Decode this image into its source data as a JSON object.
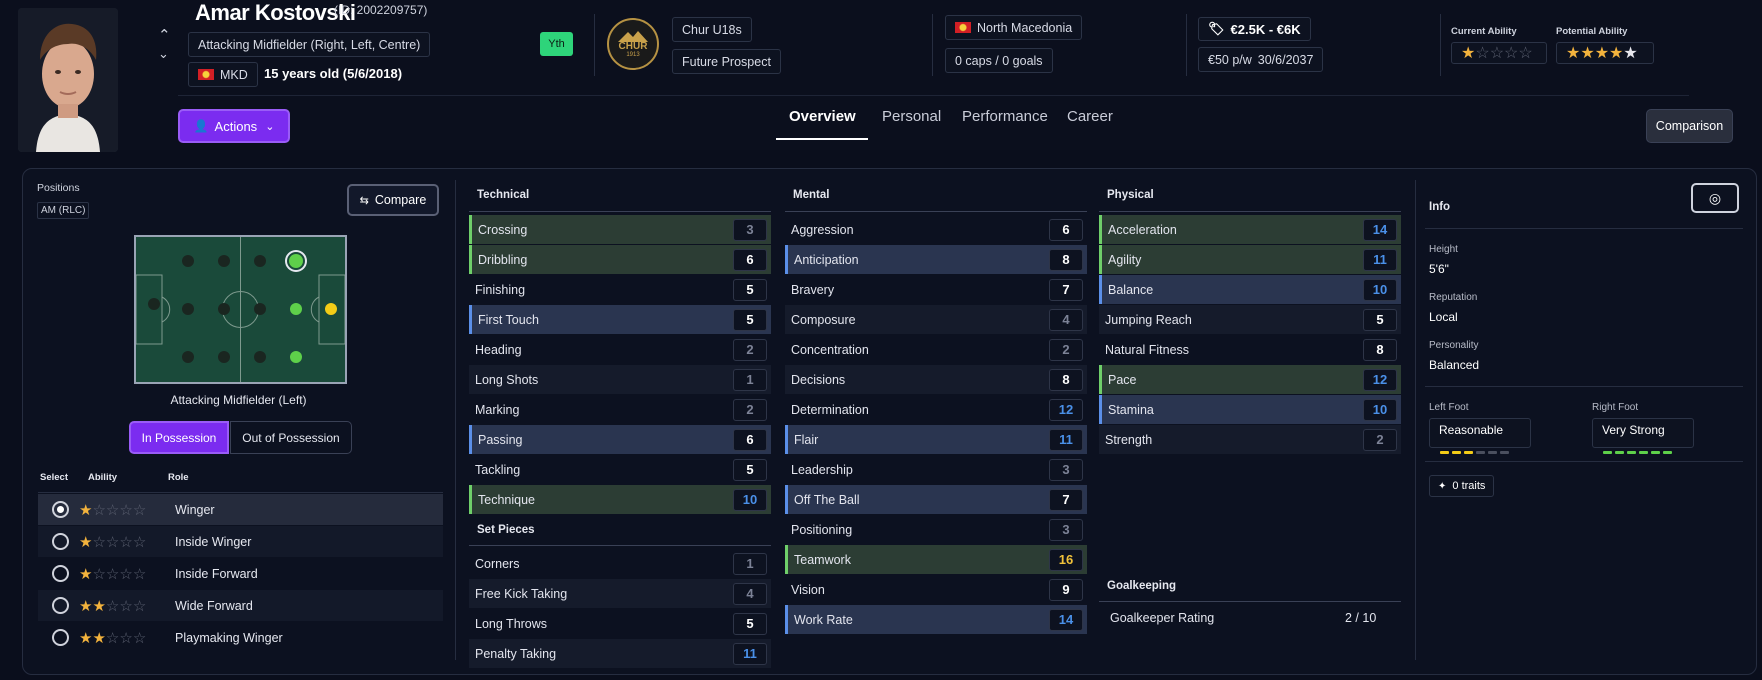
{
  "player": {
    "name": "Amar Kostovski",
    "id": "(ID: 2002209757)",
    "position": "Attacking Midfielder (Right, Left, Centre)",
    "nationality_code": "MKD",
    "age": "15 years old (5/6/2018)",
    "youth_badge": "Yth",
    "club_logo_text": "CHUR",
    "club_logo_year": "1913",
    "team": "Chur U18s",
    "status": "Future Prospect",
    "country": "North Macedonia",
    "caps": "0 caps / 0 goals",
    "value": "€2.5K - €6K",
    "wage": "€50 p/w",
    "contract": "30/6/2037",
    "current_ability_label": "Current Ability",
    "potential_ability_label": "Potential Ability",
    "current_ability_stars": 1,
    "potential_ability_stars": 4.5
  },
  "toolbar": {
    "actions_label": "Actions",
    "comparison_label": "Comparison"
  },
  "tabs": [
    "Overview",
    "Personal",
    "Performance",
    "Career"
  ],
  "positions_panel": {
    "title": "Positions",
    "short": "AM (RLC)",
    "compare_label": "Compare",
    "pitch_caption": "Attacking Midfielder (Left)",
    "in_possession": "In Possession",
    "out_possession": "Out of Possession",
    "col_select": "Select",
    "col_ability": "Ability",
    "col_role": "Role",
    "roles": [
      {
        "name": "Winger",
        "stars": 1,
        "selected": true
      },
      {
        "name": "Inside Winger",
        "stars": 1,
        "selected": false
      },
      {
        "name": "Inside Forward",
        "stars": 1,
        "selected": false
      },
      {
        "name": "Wide Forward",
        "stars": 2,
        "selected": false
      },
      {
        "name": "Playmaking Winger",
        "stars": 2,
        "selected": false
      }
    ]
  },
  "technical": {
    "title": "Technical",
    "rows": [
      {
        "name": "Crossing",
        "value": "3",
        "hl": "green"
      },
      {
        "name": "Dribbling",
        "value": "6",
        "hl": "green"
      },
      {
        "name": "Finishing",
        "value": "5",
        "hl": ""
      },
      {
        "name": "First Touch",
        "value": "5",
        "hl": "blue"
      },
      {
        "name": "Heading",
        "value": "2",
        "hl": ""
      },
      {
        "name": "Long Shots",
        "value": "1",
        "hl": ""
      },
      {
        "name": "Marking",
        "value": "2",
        "hl": ""
      },
      {
        "name": "Passing",
        "value": "6",
        "hl": "blue"
      },
      {
        "name": "Tackling",
        "value": "5",
        "hl": ""
      },
      {
        "name": "Technique",
        "value": "10",
        "hl": "green"
      }
    ]
  },
  "set_pieces": {
    "title": "Set Pieces",
    "rows": [
      {
        "name": "Corners",
        "value": "1",
        "hl": ""
      },
      {
        "name": "Free Kick Taking",
        "value": "4",
        "hl": ""
      },
      {
        "name": "Long Throws",
        "value": "5",
        "hl": ""
      },
      {
        "name": "Penalty Taking",
        "value": "11",
        "hl": ""
      }
    ]
  },
  "mental": {
    "title": "Mental",
    "rows": [
      {
        "name": "Aggression",
        "value": "6",
        "hl": ""
      },
      {
        "name": "Anticipation",
        "value": "8",
        "hl": "blue"
      },
      {
        "name": "Bravery",
        "value": "7",
        "hl": ""
      },
      {
        "name": "Composure",
        "value": "4",
        "hl": ""
      },
      {
        "name": "Concentration",
        "value": "2",
        "hl": ""
      },
      {
        "name": "Decisions",
        "value": "8",
        "hl": ""
      },
      {
        "name": "Determination",
        "value": "12",
        "hl": ""
      },
      {
        "name": "Flair",
        "value": "11",
        "hl": "blue"
      },
      {
        "name": "Leadership",
        "value": "3",
        "hl": ""
      },
      {
        "name": "Off The Ball",
        "value": "7",
        "hl": "blue"
      },
      {
        "name": "Positioning",
        "value": "3",
        "hl": ""
      },
      {
        "name": "Teamwork",
        "value": "16",
        "hl": "green"
      },
      {
        "name": "Vision",
        "value": "9",
        "hl": ""
      },
      {
        "name": "Work Rate",
        "value": "14",
        "hl": "blue"
      }
    ]
  },
  "physical": {
    "title": "Physical",
    "rows": [
      {
        "name": "Acceleration",
        "value": "14",
        "hl": "green"
      },
      {
        "name": "Agility",
        "value": "11",
        "hl": "green"
      },
      {
        "name": "Balance",
        "value": "10",
        "hl": "blue"
      },
      {
        "name": "Jumping Reach",
        "value": "5",
        "hl": ""
      },
      {
        "name": "Natural Fitness",
        "value": "8",
        "hl": ""
      },
      {
        "name": "Pace",
        "value": "12",
        "hl": "green"
      },
      {
        "name": "Stamina",
        "value": "10",
        "hl": "blue"
      },
      {
        "name": "Strength",
        "value": "2",
        "hl": ""
      }
    ]
  },
  "goalkeeping": {
    "title": "Goalkeeping",
    "label": "Goalkeeper Rating",
    "value": "2 / 10"
  },
  "info": {
    "title": "Info",
    "height_label": "Height",
    "height": "5'6\"",
    "reputation_label": "Reputation",
    "reputation": "Local",
    "personality_label": "Personality",
    "personality": "Balanced",
    "left_foot_label": "Left Foot",
    "left_foot": "Reasonable",
    "left_foot_level": 3,
    "right_foot_label": "Right Foot",
    "right_foot": "Very Strong",
    "right_foot_level": 6,
    "traits": "0 traits"
  },
  "colors": {
    "accent": "#7b2cf0",
    "yth": "#2ed47a",
    "green_hl": "#2c3d34",
    "blue_hl": "#2a3550",
    "blue_num": "#4a90e8",
    "gold_num": "#f1c23a",
    "grey_num": "#7c8296"
  }
}
